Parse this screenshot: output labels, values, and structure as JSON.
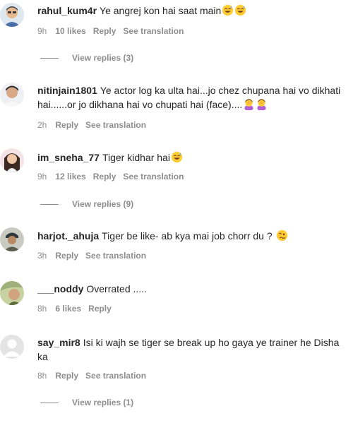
{
  "comments": [
    {
      "username": "rahul_kum4r",
      "text": "Ye angrej kon hai saat main",
      "emojis": [
        "grinning-sweat-emoji",
        "grinning-sweat-emoji"
      ],
      "time": "9h",
      "likes": "10 likes",
      "reply": "Reply",
      "translation": "See translation",
      "view_replies": "View replies (3)"
    },
    {
      "username": "nitinjain1801",
      "text": "Ye actor log ka ulta hai...jo chez chupana hai vo dikhati hai......or jo dikhana hai vo chupati hai (face)....",
      "emojis": [
        "person-facepalming-emoji",
        "person-facepalming-emoji"
      ],
      "time": "2h",
      "reply": "Reply",
      "translation": "See translation"
    },
    {
      "username": "im_sneha_77",
      "text": "Tiger kidhar hai",
      "emojis": [
        "grinning-sweat-emoji"
      ],
      "time": "9h",
      "likes": "12 likes",
      "reply": "Reply",
      "translation": "See translation",
      "view_replies": "View replies (9)"
    },
    {
      "username": "harjot._ahuja",
      "text": "Tiger be like- ab kya mai job chorr du ?",
      "emojis": [
        "woozy-face-emoji"
      ],
      "time": "3h",
      "reply": "Reply",
      "translation": "See translation"
    },
    {
      "username": "___noddy",
      "text": "Overrated .....",
      "emojis": [],
      "time": "8h",
      "likes": "6 likes",
      "reply": "Reply"
    },
    {
      "username": "say_mir8",
      "text": "Isi ki wajh se tiger se break up ho gaya ye trainer he Disha ka",
      "emojis": [],
      "time": "8h",
      "reply": "Reply",
      "translation": "See translation",
      "view_replies": "View replies (1)"
    }
  ],
  "colors": {
    "text": "#262626",
    "secondary": "#8e8e8e",
    "background": "#ffffff"
  }
}
